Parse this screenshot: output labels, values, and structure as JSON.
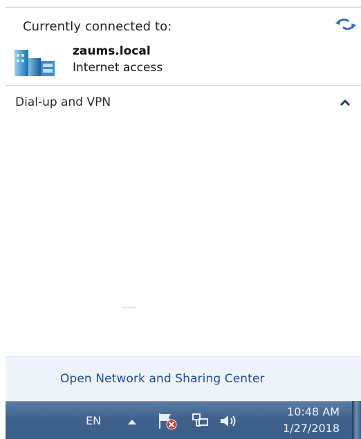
{
  "panel": {
    "connected_label": "Currently connected to:",
    "network": {
      "name": "zaums.local",
      "status": "Internet access",
      "icon": "network-domain-icon"
    },
    "refresh_icon": "refresh-icon",
    "section_label": "Dial-up and VPN",
    "section_toggle_icon": "chevron-up-icon",
    "footer_link": "Open Network and Sharing Center"
  },
  "taskbar": {
    "language": "EN",
    "time": "10:48 AM",
    "date": "1/27/2018",
    "icons": [
      "show-hidden-icons-arrow",
      "action-center-flag-icon",
      "network-tray-icon",
      "volume-icon"
    ],
    "colors": {
      "taskbar_blue": "#3f638d",
      "link_blue": "#1a4a9c",
      "footer_bg": "#eef3f9"
    }
  }
}
